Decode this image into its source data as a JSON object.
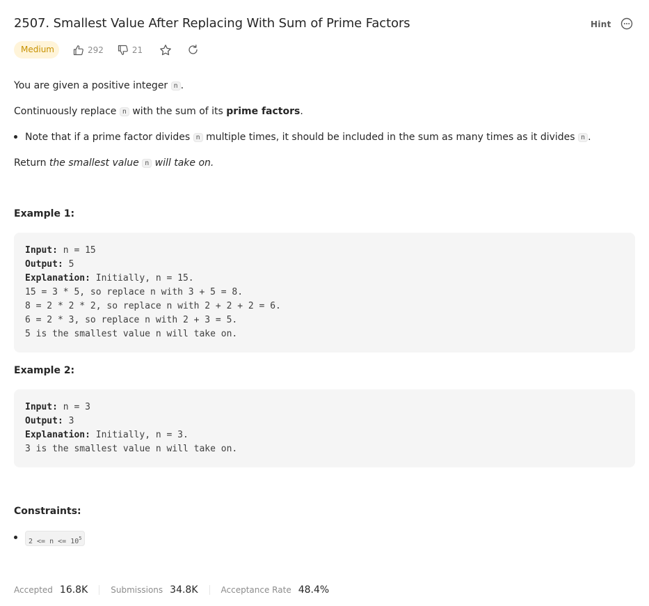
{
  "problem": {
    "title": "2507. Smallest Value After Replacing With Sum of Prime Factors",
    "hint_label": "Hint",
    "difficulty": "Medium",
    "likes": "292",
    "dislikes": "21"
  },
  "description": {
    "p1_before": "You are given a positive integer ",
    "p1_code": "n",
    "p1_after": ".",
    "p2_before": "Continuously replace ",
    "p2_code": "n",
    "p2_mid": " with the sum of its ",
    "p2_bold": "prime factors",
    "p2_after": ".",
    "li_before": "Note that if a prime factor divides ",
    "li_code1": "n",
    "li_mid": " multiple times, it should be included in the sum as many times as it divides ",
    "li_code2": "n",
    "li_after": ".",
    "p3_before": "Return ",
    "p3_em1": "the smallest value ",
    "p3_code": "n",
    "p3_em2": " will take on."
  },
  "examples": [
    {
      "heading": "Example 1:",
      "input_label": "Input:",
      "input_val": " n = 15",
      "output_label": "Output:",
      "output_val": " 5",
      "explanation_label": "Explanation:",
      "explanation_val": " Initially, n = 15.",
      "lines": [
        "15 = 3 * 5, so replace n with 3 + 5 = 8.",
        "8 = 2 * 2 * 2, so replace n with 2 + 2 + 2 = 6.",
        "6 = 2 * 3, so replace n with 2 + 3 = 5.",
        "5 is the smallest value n will take on."
      ]
    },
    {
      "heading": "Example 2:",
      "input_label": "Input:",
      "input_val": " n = 3",
      "output_label": "Output:",
      "output_val": " 3",
      "explanation_label": "Explanation:",
      "explanation_val": " Initially, n = 3.",
      "lines": [
        "3 is the smallest value n will take on."
      ]
    }
  ],
  "constraints": {
    "heading": "Constraints:",
    "item_base": "2 <= n <= 10",
    "item_exp": "5"
  },
  "stats": {
    "accepted_label": "Accepted",
    "accepted_value": "16.8K",
    "submissions_label": "Submissions",
    "submissions_value": "34.8K",
    "rate_label": "Acceptance Rate",
    "rate_value": "48.4%"
  },
  "colors": {
    "medium_badge_bg": "#fff4d9",
    "medium_badge_text": "#c79100",
    "code_bg": "#f5f5f5"
  },
  "icons": [
    "thumbs-up-icon",
    "thumbs-down-icon",
    "star-icon",
    "refresh-icon",
    "more-icon"
  ]
}
